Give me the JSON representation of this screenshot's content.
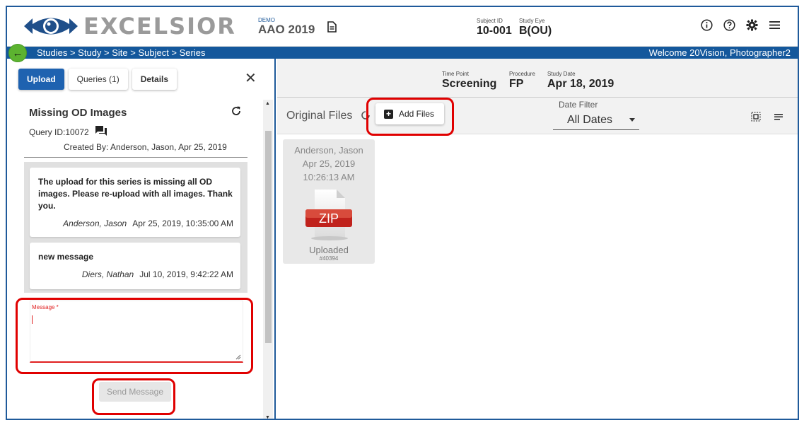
{
  "header": {
    "logo_text": "EXCELSIOR",
    "demo_label": "DEMO",
    "study_name": "AAO 2019",
    "subject_id_label": "Subject ID",
    "subject_id": "10-001",
    "study_eye_label": "Study Eye",
    "study_eye": "B(OU)",
    "icons": [
      "info-icon",
      "help-icon",
      "gear-icon",
      "menu-icon"
    ]
  },
  "breadcrumb": {
    "path": "Studies > Study > Site > Subject > Series",
    "welcome": "Welcome 20Vision, Photographer2"
  },
  "left_panel": {
    "tabs": [
      {
        "label": "Upload",
        "active": true
      },
      {
        "label": "Queries (1)",
        "active": false
      },
      {
        "label": "Details",
        "active": false
      }
    ],
    "query": {
      "title": "Missing OD Images",
      "id_text": "Query ID:10072",
      "created_by": "Created By: Anderson, Jason, Apr 25, 2019"
    },
    "messages": [
      {
        "text": "The upload for this series is missing all OD images. Please re-upload with all images. Thank you.",
        "author": "Anderson, Jason",
        "date": "Apr 25, 2019, 10:35:00 AM"
      },
      {
        "text": "new message",
        "author": "Diers, Nathan",
        "date": "Jul 10, 2019, 9:42:22 AM"
      }
    ],
    "message_field": {
      "label": "Message *",
      "value": ""
    },
    "send_button": "Send Message"
  },
  "right_panel": {
    "time_point_label": "Time Point",
    "time_point": "Screening",
    "procedure_label": "Procedure",
    "procedure": "FP",
    "study_date_label": "Study Date",
    "study_date": "Apr 18, 2019",
    "original_files_label": "Original Files",
    "add_files_button": "Add Files",
    "date_filter_label": "Date Filter",
    "date_filter_value": "All Dates",
    "files": [
      {
        "uploader": "Anderson, Jason",
        "date": "Apr 25, 2019",
        "time": "10:26:13 AM",
        "type_badge": "ZIP",
        "status": "Uploaded",
        "number": "#40394"
      }
    ]
  },
  "colors": {
    "brand_blue": "#14589c",
    "tab_active": "#1e62b0",
    "back_green": "#5cb330",
    "annotation_red": "#e00000",
    "zip_red": "#c0221c"
  }
}
